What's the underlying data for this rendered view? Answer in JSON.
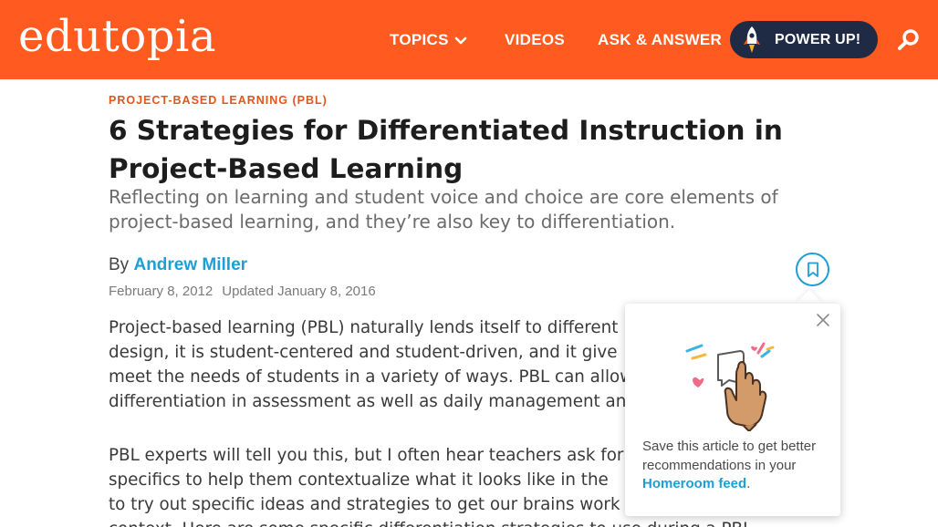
{
  "header": {
    "logo_text": "edutopia",
    "nav": {
      "topics": "TOPICS",
      "videos": "VIDEOS",
      "ask": "ASK & ANSWER"
    },
    "powerup_label": "POWER UP!",
    "brand_color": "#ff5a1f"
  },
  "article": {
    "category": "PROJECT-BASED LEARNING (PBL)",
    "title": "6 Strategies for Differentiated Instruction in Project-Based Learning",
    "subtitle": "Reflecting on learning and student voice and choice are core elements of project-based learning, and they’re also key to differentiation.",
    "by_prefix": "By",
    "author": "Andrew Miller",
    "published": "February 8, 2012",
    "updated": "Updated January 8, 2016",
    "paragraph1_lines": [
      "Project-based learning (PBL) naturally lends itself to different",
      "design, it is student-centered and student-driven, and it give",
      "meet the needs of students in a variety of ways. PBL can allow",
      "differentiation in assessment as well as daily management an"
    ],
    "paragraph2_lines": [
      "PBL experts will tell you this, but I often hear teachers ask for",
      "specifics to help them contextualize what it looks like in the",
      "to try out specific ideas and strategies to get our brains work",
      "context. Here are some specific differentiation strategies to use during a PBL"
    ]
  },
  "save_popover": {
    "message_prefix": "Save this article to get better recommendations in your ",
    "link_text": "Homeroom feed",
    "message_suffix": "."
  }
}
